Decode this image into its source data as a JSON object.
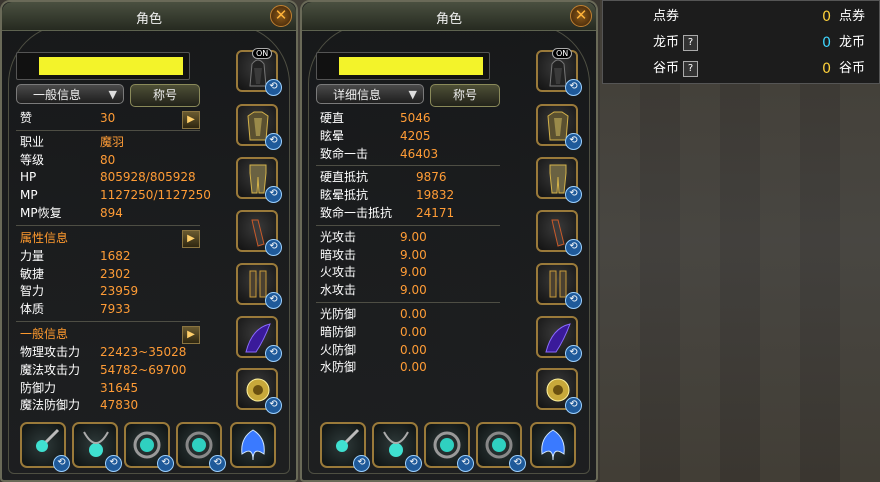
{
  "left_panel": {
    "title": "角色",
    "close": "✕",
    "dropdown": "一般信息",
    "title_button": "称号",
    "rows_top": [
      {
        "label": "赞",
        "value": "30"
      }
    ],
    "rows_basic": [
      {
        "label": "职业",
        "value": "魔羽"
      },
      {
        "label": "等级",
        "value": "80"
      },
      {
        "label": "HP",
        "value": "805928/805928"
      },
      {
        "label": "MP",
        "value": "1127250/1127250"
      },
      {
        "label": "MP恢复",
        "value": "894"
      }
    ],
    "attr_header": "属性信息",
    "rows_attr": [
      {
        "label": "力量",
        "value": "1682"
      },
      {
        "label": "敏捷",
        "value": "2302"
      },
      {
        "label": "智力",
        "value": "23959"
      },
      {
        "label": "体质",
        "value": "7933"
      }
    ],
    "general_header": "一般信息",
    "rows_general": [
      {
        "label": "物理攻击力",
        "value": "22423~35028"
      },
      {
        "label": "魔法攻击力",
        "value": "54782~69700"
      },
      {
        "label": "防御力",
        "value": "31645"
      },
      {
        "label": "魔法防御力",
        "value": "47830"
      }
    ]
  },
  "mid_panel": {
    "title": "角色",
    "close": "✕",
    "dropdown": "详细信息",
    "title_button": "称号",
    "group1": [
      {
        "label": "硬直",
        "value": "5046"
      },
      {
        "label": "眩晕",
        "value": "4205"
      },
      {
        "label": "致命一击",
        "value": "46403"
      }
    ],
    "group2": [
      {
        "label": "硬直抵抗",
        "value": "9876"
      },
      {
        "label": "眩晕抵抗",
        "value": "19832"
      },
      {
        "label": "致命一击抵抗",
        "value": "24171"
      }
    ],
    "group3": [
      {
        "label": "光攻击",
        "value": "9.00"
      },
      {
        "label": "暗攻击",
        "value": "9.00"
      },
      {
        "label": "火攻击",
        "value": "9.00"
      },
      {
        "label": "水攻击",
        "value": "9.00"
      }
    ],
    "group4": [
      {
        "label": "光防御",
        "value": "0.00"
      },
      {
        "label": "暗防御",
        "value": "0.00"
      },
      {
        "label": "火防御",
        "value": "0.00"
      },
      {
        "label": "水防御",
        "value": "0.00"
      }
    ]
  },
  "equipment": {
    "on_badge": "ON",
    "slots": [
      "helmet-icon",
      "chest-armor-icon",
      "leg-armor-icon",
      "gloves-icon",
      "boots-icon",
      "wing-icon",
      "wreath-icon"
    ],
    "bottom_slots": [
      "weapon-icon",
      "necklace-icon",
      "ring-icon",
      "earring-icon",
      "emblem-icon"
    ]
  },
  "currency": {
    "rows": [
      {
        "label": "点券",
        "value": "0",
        "unit": "点券",
        "has_help": false
      },
      {
        "label": "龙币",
        "value": "0",
        "unit": "龙币",
        "has_help": true
      },
      {
        "label": "谷币",
        "value": "0",
        "unit": "谷币",
        "has_help": true
      }
    ],
    "help": "?",
    "colors": {
      "orange": "#ff9c36",
      "cyan": "#3fd6ff",
      "yellow": "#ffd23a"
    }
  }
}
